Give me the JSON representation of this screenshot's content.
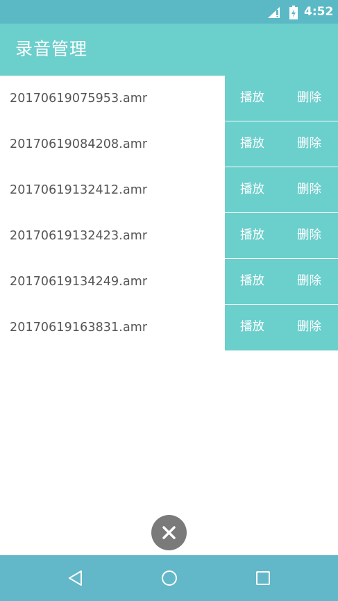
{
  "status_bar": {
    "time": "4:52",
    "icons": [
      "signal-icon",
      "battery-icon"
    ]
  },
  "app_bar": {
    "title": "录音管理"
  },
  "recordings": [
    {
      "filename": "20170619075953.amr",
      "play_label": "播放",
      "delete_label": "删除"
    },
    {
      "filename": "20170619084208.amr",
      "play_label": "播放",
      "delete_label": "删除"
    },
    {
      "filename": "20170619132412.amr",
      "play_label": "播放",
      "delete_label": "删除"
    },
    {
      "filename": "20170619132423.amr",
      "play_label": "播放",
      "delete_label": "删除"
    },
    {
      "filename": "20170619134249.amr",
      "play_label": "播放",
      "delete_label": "删除"
    },
    {
      "filename": "20170619163831.amr",
      "play_label": "播放",
      "delete_label": "删除"
    }
  ],
  "fab": {
    "icon": "close-icon"
  },
  "nav_bar": {
    "icons": [
      "back-icon",
      "home-icon",
      "recents-icon"
    ]
  },
  "colors": {
    "status_bar": "#5bb9c6",
    "accent": "#6bcfcc",
    "nav_bar": "#62b8c9",
    "fab": "#7a7a7a",
    "list_text": "#555555"
  }
}
